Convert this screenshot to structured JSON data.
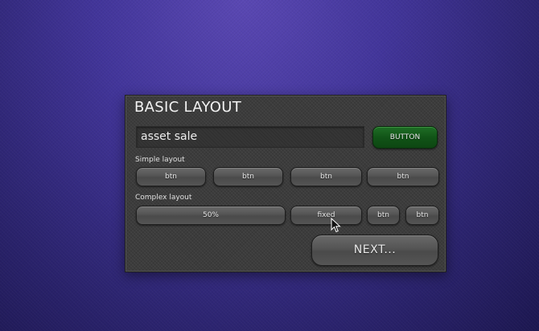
{
  "panel": {
    "title": "BASIC LAYOUT",
    "text_field": {
      "value": "asset sale"
    },
    "button_label": "BUTTON",
    "simple_layout": {
      "label": "Simple layout",
      "buttons": [
        "btn",
        "btn",
        "btn",
        "btn"
      ]
    },
    "complex_layout": {
      "label": "Complex layout",
      "buttons": [
        "50%",
        "fixed",
        "btn",
        "btn"
      ]
    },
    "next_label": "NEXT..."
  },
  "colors": {
    "accent_green": "#115417",
    "panel_bg": "#3c3c3c",
    "desktop_bg": "#42359a"
  },
  "icons": {
    "cursor": "mouse-pointer-icon"
  }
}
